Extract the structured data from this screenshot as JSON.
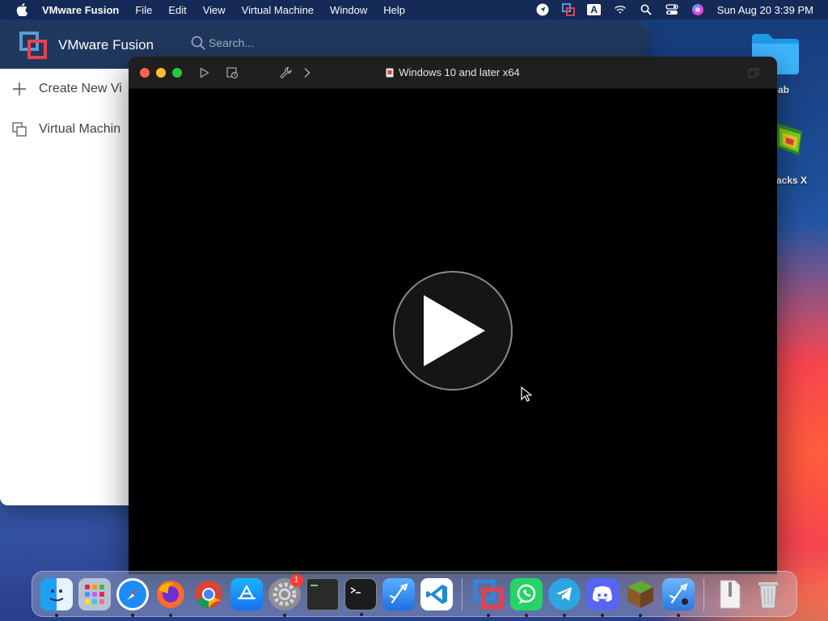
{
  "menubar": {
    "app_name": "VMware Fusion",
    "menus": [
      "File",
      "Edit",
      "View",
      "Virtual Machine",
      "Window",
      "Help"
    ],
    "status_icons": [
      "location-icon",
      "vmware-status-icon",
      "keyboard-input-icon",
      "wifi-icon",
      "spotlight-search-icon",
      "control-center-icon",
      "siri-icon"
    ],
    "input_source": "A",
    "clock": "Sun Aug 20  3:39 PM"
  },
  "desktop": {
    "icons": [
      {
        "name": "folder-icon",
        "label": "ab"
      },
      {
        "name": "bluestacks-icon",
        "label": "acks X"
      }
    ]
  },
  "library": {
    "title": "VMware Fusion",
    "search_placeholder": "Search...",
    "sidebar": [
      {
        "label": "Create New Vi",
        "icon": "plus-icon"
      },
      {
        "label": "Virtual Machin",
        "icon": "virtual-machines-icon"
      }
    ]
  },
  "vm_window": {
    "title": "Windows 10 and later x64",
    "toolbar": [
      "play-icon",
      "snapshot-icon",
      "settings-wrench-icon",
      "forward-chevron-icon"
    ]
  },
  "dock": {
    "apps": [
      {
        "name": "finder",
        "running": true
      },
      {
        "name": "launchpad",
        "running": false
      },
      {
        "name": "safari",
        "running": true
      },
      {
        "name": "firefox",
        "running": true
      },
      {
        "name": "chrome",
        "running": false
      },
      {
        "name": "app-store",
        "running": false
      },
      {
        "name": "system-settings",
        "running": true,
        "badge": "1"
      },
      {
        "name": "exec-terminal",
        "running": false
      },
      {
        "name": "terminal",
        "running": true
      },
      {
        "name": "xcode",
        "running": false
      },
      {
        "name": "vscode",
        "running": false
      },
      {
        "name": "vmware-fusion",
        "running": true
      },
      {
        "name": "whatsapp",
        "running": true
      },
      {
        "name": "telegram",
        "running": true
      },
      {
        "name": "discord",
        "running": true
      },
      {
        "name": "minecraft",
        "running": true
      },
      {
        "name": "xcode-beta",
        "running": true
      },
      {
        "name": "archive-utility",
        "running": false
      },
      {
        "name": "trash",
        "running": false
      }
    ]
  }
}
